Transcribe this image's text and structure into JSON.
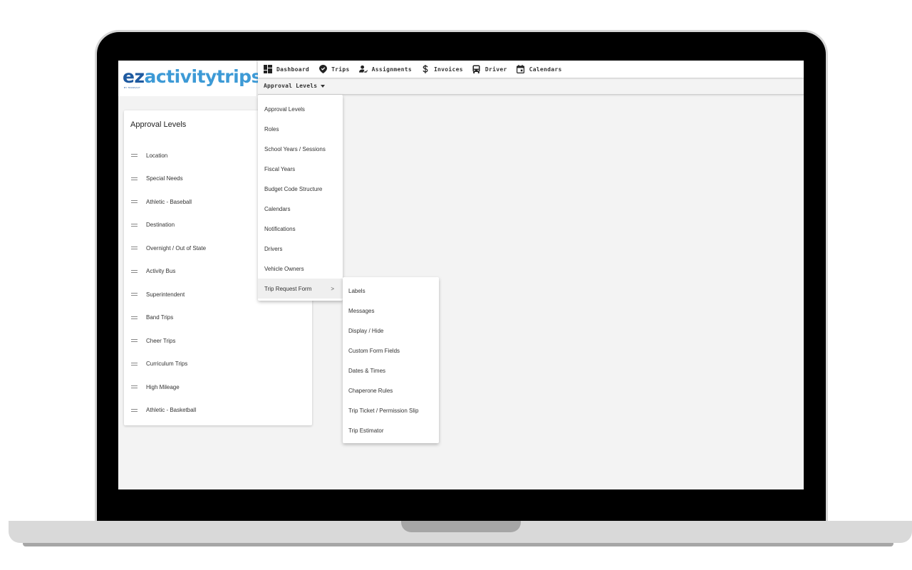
{
  "app": {
    "logo_primary": "ez",
    "logo_secondary": "activitytrips",
    "logo_tagline": "BY TRANSACT"
  },
  "topnav": {
    "items": [
      {
        "label": "Dashboard",
        "icon": "dashboard-icon"
      },
      {
        "label": "Trips",
        "icon": "map-pin-icon"
      },
      {
        "label": "Assignments",
        "icon": "user-assign-icon"
      },
      {
        "label": "Invoices",
        "icon": "dollar-icon"
      },
      {
        "label": "Driver",
        "icon": "bus-icon"
      },
      {
        "label": "Calendars",
        "icon": "calendar-icon"
      }
    ]
  },
  "subnav": {
    "dropdown_label": "Approval Levels"
  },
  "card": {
    "title": "Approval Levels",
    "items": [
      "Location",
      "Special Needs",
      "Athletic - Baseball",
      "Destination",
      "Overnight / Out of State",
      "Activity Bus",
      "Superintendent",
      "Band Trips",
      "Cheer Trips",
      "Curriculum Trips",
      "High Mileage",
      "Athletic - Basketball"
    ]
  },
  "menu": {
    "items": [
      "Approval Levels",
      "Roles",
      "School Years / Sessions",
      "Fiscal Years",
      "Budget Code Structure",
      "Calendars",
      "Notifications",
      "Drivers",
      "Vehicle Owners",
      "Trip Request Form"
    ],
    "submenu_arrow": ">",
    "active_index": 9
  },
  "submenu": {
    "items": [
      "Labels",
      "Messages",
      "Display / Hide",
      "Custom Form Fields",
      "Dates & Times",
      "Chaperone Rules",
      "Trip Ticket / Permission Slip",
      "Trip Estimator"
    ]
  }
}
